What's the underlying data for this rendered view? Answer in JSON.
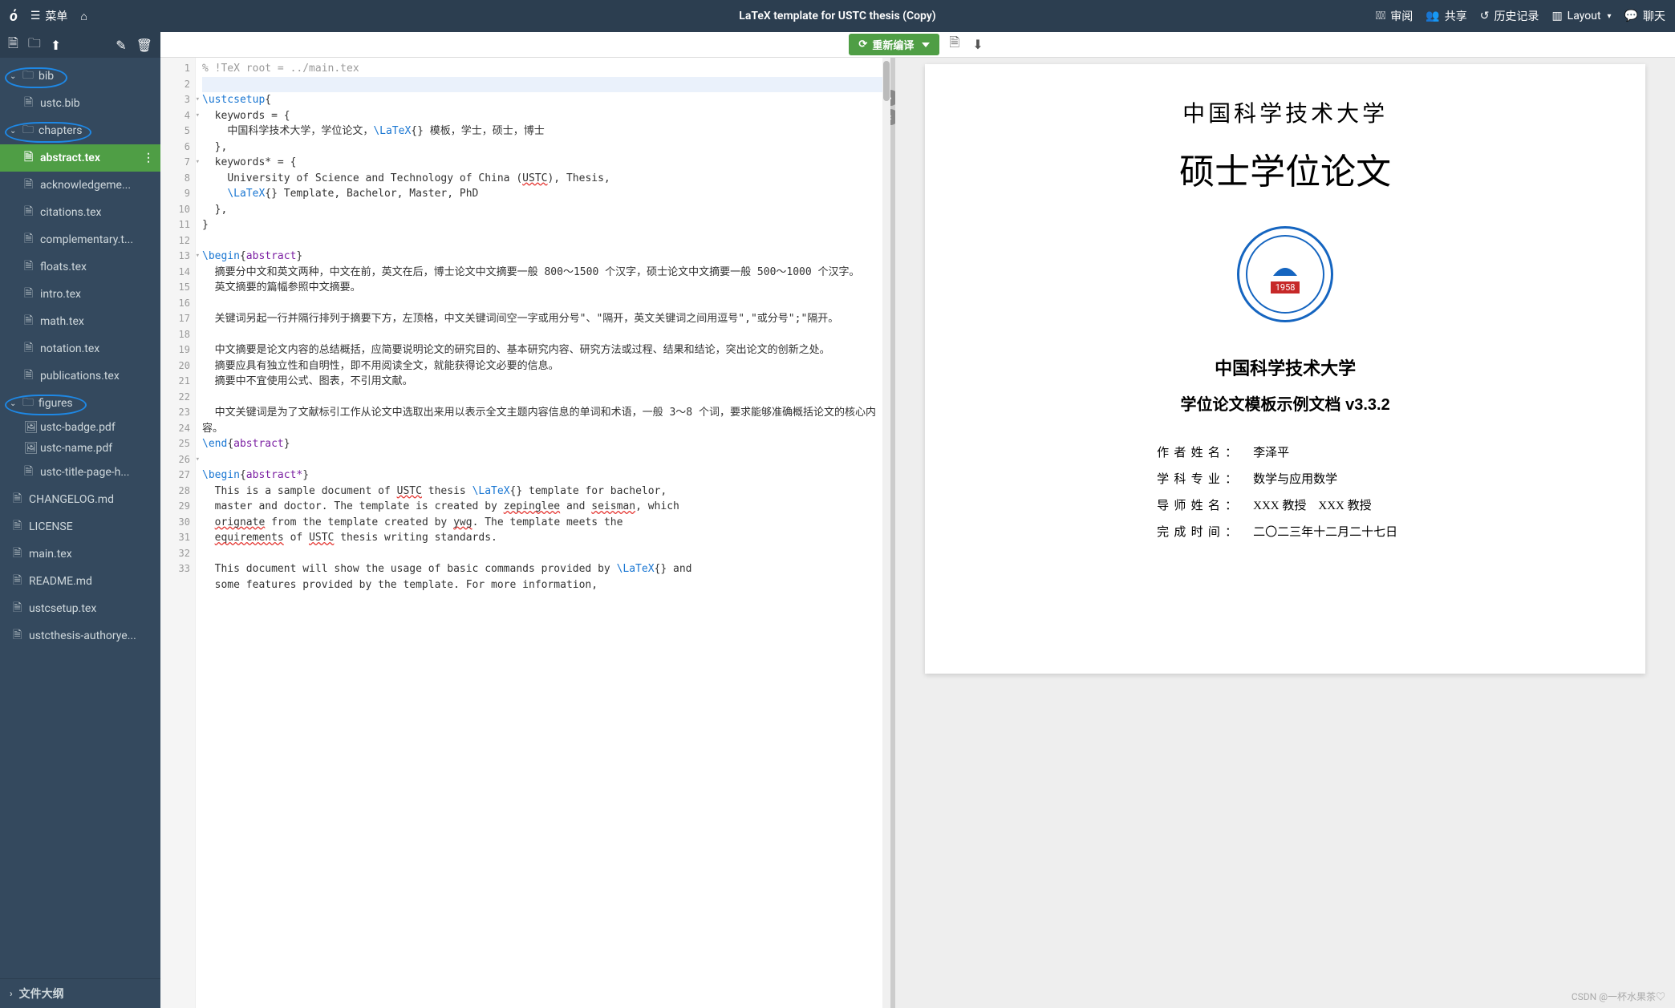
{
  "topbar": {
    "menu": "菜单",
    "title": "LaTeX template for USTC thesis (Copy)",
    "review": "审阅",
    "share": "共享",
    "history": "历史记录",
    "layout": "Layout",
    "chat": "聊天"
  },
  "toolbar": {
    "recompile": "重新编译"
  },
  "sidebar": {
    "outline": "文件大纲",
    "folders": [
      {
        "name": "bib",
        "files": [
          "ustc.bib"
        ]
      },
      {
        "name": "chapters",
        "files": [
          "abstract.tex",
          "acknowledgeme...",
          "citations.tex",
          "complementary.t...",
          "floats.tex",
          "intro.tex",
          "math.tex",
          "notation.tex",
          "publications.tex"
        ]
      },
      {
        "name": "figures",
        "files": [
          "ustc-badge.pdf",
          "ustc-name.pdf",
          "ustc-title-page-h..."
        ]
      }
    ],
    "root_files": [
      "CHANGELOG.md",
      "LICENSE",
      "main.tex",
      "README.md",
      "ustcsetup.tex",
      "ustcthesis-authorye..."
    ],
    "active": "abstract.tex"
  },
  "editor": {
    "lines": [
      {
        "n": 1,
        "cls": "",
        "html": "<span class='tok-comment'>% !TeX root = ../main.tex</span>"
      },
      {
        "n": 2,
        "cls": "hl",
        "html": ""
      },
      {
        "n": 3,
        "cls": "",
        "fold": true,
        "html": "<span class='tok-cmd'>\\ustcsetup</span>{"
      },
      {
        "n": 4,
        "cls": "",
        "fold": true,
        "html": "  keywords = {"
      },
      {
        "n": 5,
        "cls": "",
        "html": "    中国科学技术大学，学位论文，<span class='tok-cmd'>\\LaTeX</span>{} 模板，学士，硕士，博士"
      },
      {
        "n": 6,
        "cls": "",
        "html": "  },"
      },
      {
        "n": 7,
        "cls": "",
        "fold": true,
        "html": "  keywords* = {"
      },
      {
        "n": 8,
        "cls": "",
        "html": "    University of Science and Technology of China (<span class='tok-spell'>USTC</span>), Thesis,"
      },
      {
        "n": 9,
        "cls": "",
        "html": "    <span class='tok-cmd'>\\LaTeX</span>{} Template, Bachelor, Master, PhD"
      },
      {
        "n": 10,
        "cls": "",
        "html": "  },"
      },
      {
        "n": 11,
        "cls": "",
        "html": "}"
      },
      {
        "n": 12,
        "cls": "",
        "html": ""
      },
      {
        "n": 13,
        "cls": "",
        "fold": true,
        "html": "<span class='tok-cmd'>\\begin</span>{<span class='tok-env'>abstract</span>}"
      },
      {
        "n": 14,
        "cls": "",
        "html": "  摘要分中文和英文两种，中文在前，英文在后，博士论文中文摘要一般 800～1500 个汉字，硕士论文中文摘要一般 500～1000 个汉字。"
      },
      {
        "n": 15,
        "cls": "",
        "html": "  英文摘要的篇幅参照中文摘要。"
      },
      {
        "n": 16,
        "cls": "",
        "html": ""
      },
      {
        "n": 17,
        "cls": "",
        "html": "  关键词另起一行并隔行排列于摘要下方，左顶格，中文关键词间空一字或用分号\"、\"隔开，英文关键词之间用逗号\",\"或分号\";\"隔开。"
      },
      {
        "n": 18,
        "cls": "",
        "html": ""
      },
      {
        "n": 19,
        "cls": "",
        "html": "  中文摘要是论文内容的总结概括，应简要说明论文的研究目的、基本研究内容、研究方法或过程、结果和结论，突出论文的创新之处。"
      },
      {
        "n": 20,
        "cls": "",
        "html": "  摘要应具有独立性和自明性，即不用阅读全文，就能获得论文必要的信息。"
      },
      {
        "n": 21,
        "cls": "",
        "html": "  摘要中不宜使用公式、图表，不引用文献。"
      },
      {
        "n": 22,
        "cls": "",
        "html": ""
      },
      {
        "n": 23,
        "cls": "",
        "html": "  中文关键词是为了文献标引工作从论文中选取出来用以表示全文主题内容信息的单词和术语，一般 3～8 个词，要求能够准确概括论文的核心内容。"
      },
      {
        "n": 24,
        "cls": "",
        "html": "<span class='tok-cmd'>\\end</span>{<span class='tok-env'>abstract</span>}"
      },
      {
        "n": 25,
        "cls": "",
        "html": ""
      },
      {
        "n": 26,
        "cls": "",
        "fold": true,
        "html": "<span class='tok-cmd'>\\begin</span>{<span class='tok-env'>abstract*</span>}"
      },
      {
        "n": 27,
        "cls": "",
        "html": "  This is a sample document of <span class='tok-spell'>USTC</span> thesis <span class='tok-cmd'>\\LaTeX</span>{} template for bachelor,"
      },
      {
        "n": 28,
        "cls": "",
        "html": "  master and doctor. The template is created by <span class='tok-spell'>zepinglee</span> and <span class='tok-spell'>seisman</span>, which"
      },
      {
        "n": 29,
        "cls": "",
        "html": "  <span class='tok-spell'>orignate</span> from the template created by <span class='tok-spell'>ywg</span>. The template meets the"
      },
      {
        "n": 30,
        "cls": "",
        "html": "  <span class='tok-spell'>equirements</span> of <span class='tok-spell'>USTC</span> thesis writing standards."
      },
      {
        "n": 31,
        "cls": "",
        "html": ""
      },
      {
        "n": 32,
        "cls": "",
        "html": "  This document will show the usage of basic commands provided by <span class='tok-cmd'>\\LaTeX</span>{} and"
      },
      {
        "n": 33,
        "cls": "",
        "html": "  some features provided by the template. For more information,"
      }
    ]
  },
  "preview": {
    "university_script": "中国科学技术大学",
    "big_title": "硕士学位论文",
    "badge_year": "1958",
    "sub1": "中国科学技术大学",
    "sub2": "学位论文模板示例文档 v3.3.2",
    "info": {
      "author_k": "作者姓名：",
      "author_v": "李泽平",
      "major_k": "学科专业：",
      "major_v": "数学与应用数学",
      "advisor_k": "导师姓名：",
      "advisor_v": "XXX 教授　XXX 教授",
      "date_k": "完成时间：",
      "date_v": "二〇二三年十二月二十七日"
    }
  },
  "watermark": "CSDN @一杯水果茶♡"
}
